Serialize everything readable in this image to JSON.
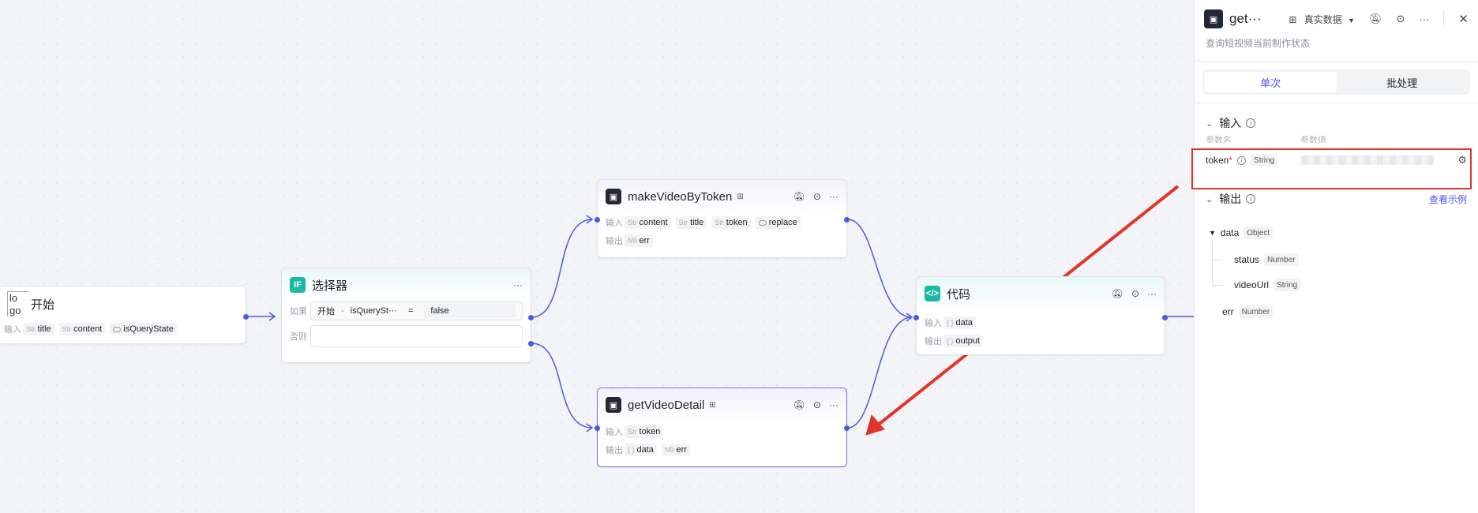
{
  "nodes": {
    "start": {
      "logo_alt": "lo go",
      "title": "开始",
      "input_label": "输入",
      "inputs": [
        {
          "type": "Str",
          "name": "title"
        },
        {
          "type": "Str",
          "name": "content"
        },
        {
          "type": "bool",
          "name": "isQueryState"
        }
      ]
    },
    "selector": {
      "icon": "IF",
      "title": "选择器",
      "more": "···",
      "if_label": "如果",
      "else_label": "否则",
      "condition": {
        "left": "开始",
        "sep": "-",
        "var": "isQuerySt···",
        "op": "=",
        "value": "false"
      }
    },
    "make_video": {
      "title": "makeVideoByToken",
      "input_label": "输入",
      "output_label": "输出",
      "inputs": [
        {
          "type": "Str",
          "name": "content"
        },
        {
          "type": "Str",
          "name": "title"
        },
        {
          "type": "Str",
          "name": "token"
        },
        {
          "type": "bool",
          "name": "replace"
        }
      ],
      "outputs": [
        {
          "type": "N9",
          "name": "err"
        }
      ]
    },
    "get_detail": {
      "title": "getVideoDetail",
      "input_label": "输入",
      "output_label": "输出",
      "inputs": [
        {
          "type": "Str",
          "name": "token"
        }
      ],
      "outputs": [
        {
          "type": "{ }",
          "name": "data"
        },
        {
          "type": "N9",
          "name": "err"
        }
      ]
    },
    "code": {
      "title": "代码",
      "input_label": "输入",
      "output_label": "输出",
      "inputs": [
        {
          "type": "{ }",
          "name": "data"
        }
      ],
      "outputs": [
        {
          "type": "{ }",
          "name": "output"
        }
      ]
    }
  },
  "panel": {
    "title": "get···",
    "data_mode": "真实数据",
    "subtitle": "查询短视频当前制作状态",
    "tabs": {
      "single": "单次",
      "batch": "批处理"
    },
    "input_section": "输入",
    "col_name": "参数名",
    "col_value": "参数值",
    "token_param": {
      "name": "token",
      "required": "*",
      "type": "String"
    },
    "output_section": "输出",
    "view_example": "查看示例",
    "outputs": {
      "data": {
        "name": "data",
        "type": "Object"
      },
      "status": {
        "name": "status",
        "type": "Number"
      },
      "videoUrl": {
        "name": "videoUrl",
        "type": "String"
      },
      "err": {
        "name": "err",
        "type": "Number"
      }
    }
  },
  "colors": {
    "accent": "#4d53e8",
    "edge": "#4f58e0",
    "highlight": "#e0352b",
    "teal": "#1bb8a8"
  }
}
